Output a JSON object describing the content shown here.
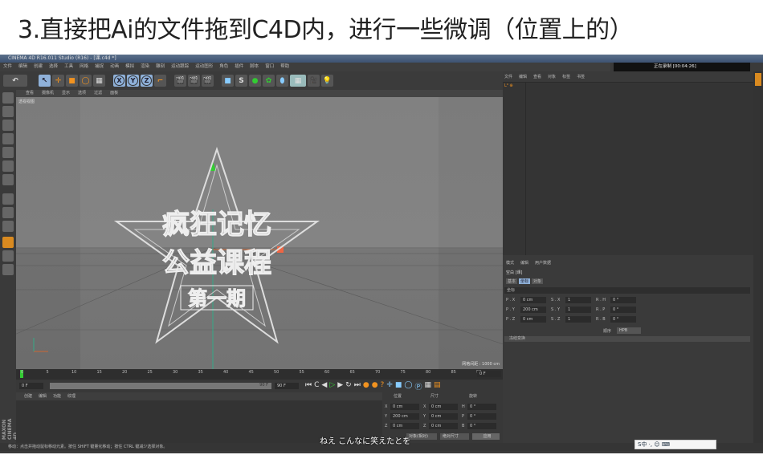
{
  "heading": "3.直接把Ai的文件拖到C4D内，进行一些微调（位置上的）",
  "window": {
    "title": "CINEMA 4D R16.011 Studio (R16) - [课.c4d *]"
  },
  "menu": [
    "文件",
    "编辑",
    "创建",
    "选择",
    "工具",
    "网格",
    "捕捉",
    "动画",
    "模拟",
    "渲染",
    "雕刻",
    "运动跟踪",
    "运动图形",
    "角色",
    "插件",
    "脚本",
    "窗口",
    "帮助"
  ],
  "toolbar": {
    "x": "X",
    "y": "Y",
    "z": "Z"
  },
  "recorder": {
    "label": "正在录制 [00:04:26]"
  },
  "viewport": {
    "menu": [
      "查看",
      "摄像机",
      "显示",
      "选项",
      "过滤",
      "面板"
    ],
    "label": "透视视图",
    "grid": "网格间距 : 1000 cm"
  },
  "watermark": {
    "line1": "疯狂记忆",
    "line2": "公益课程",
    "line3": "第一期"
  },
  "timeline": {
    "ticks": [
      "0",
      "5",
      "10",
      "15",
      "20",
      "25",
      "30",
      "35",
      "40",
      "45",
      "50",
      "55",
      "60",
      "65",
      "70",
      "75",
      "80",
      "85",
      "90"
    ],
    "current": "0 F",
    "start": "0 F",
    "end": "90 F",
    "range_end": "90 F"
  },
  "material": {
    "menu": [
      "创建",
      "编辑",
      "功能",
      "纹理"
    ]
  },
  "coords": {
    "headers": [
      "位置",
      "尺寸",
      "旋转"
    ],
    "rows": [
      [
        "X",
        "0 cm",
        "X",
        "0 cm",
        "H",
        "0 °"
      ],
      [
        "Y",
        "200 cm",
        "Y",
        "0 cm",
        "P",
        "0 °"
      ],
      [
        "Z",
        "0 cm",
        "Z",
        "0 cm",
        "B",
        "0 °"
      ]
    ],
    "mode": "对象(相对)",
    "size_mode": "绝对尺寸",
    "apply": "应用"
  },
  "object_manager": {
    "tabs": [
      "文件",
      "编辑",
      "查看",
      "对象",
      "标签",
      "书签"
    ]
  },
  "attributes": {
    "menu": [
      "模式",
      "编辑",
      "用户数据"
    ],
    "object": "空白 [课]",
    "tabs": [
      "基本",
      "坐标",
      "对象"
    ],
    "section": "坐标",
    "rows": [
      [
        "P . X",
        "0 cm",
        "S . X",
        "1",
        "R . H",
        "0 °"
      ],
      [
        "P . Y",
        "200 cm",
        "S . Y",
        "1",
        "R . P",
        "0 °"
      ],
      [
        "P . Z",
        "0 cm",
        "S . Z",
        "1",
        "R . B",
        "0 °"
      ]
    ],
    "order_label": "顺序",
    "order": "HPB",
    "freeze": "冻结变换"
  },
  "status": "移动：点击并拖动鼠标移动元素。按住 SHIFT 键量化移动；按住 CTRL 键减少选择对象。",
  "subtitle": "ねえ こんなに笑えたとを",
  "brand": "MAXON CINEMA 4D",
  "ime": "S中 ·, ☺ ⌨"
}
